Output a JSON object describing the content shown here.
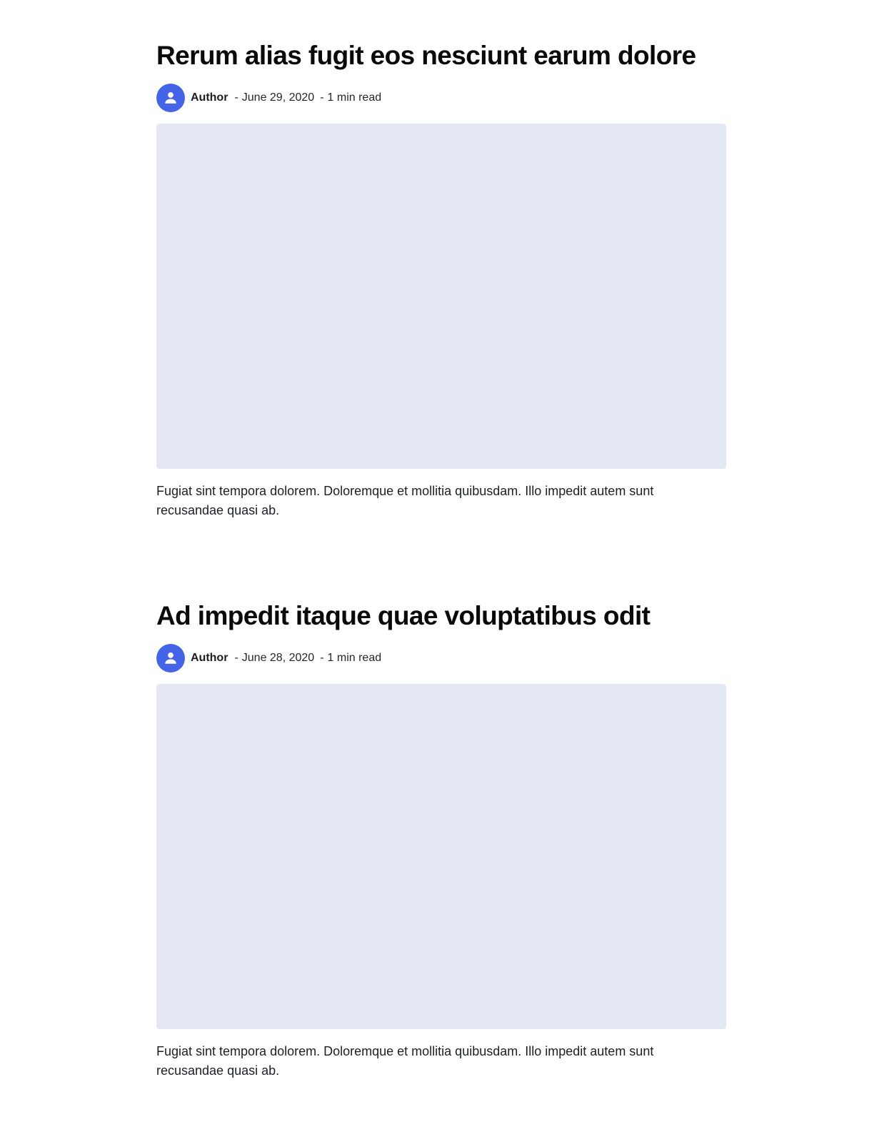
{
  "posts": [
    {
      "title": "Rerum alias fugit eos nesciunt earum dolore",
      "author": "Author",
      "date_sep": "-",
      "date": "June 29, 2020",
      "read_sep": "-",
      "read_time": "1 min read",
      "excerpt": "Fugiat sint tempora dolorem. Doloremque et mollitia quibusdam. Illo impedit autem sunt recusandae quasi ab."
    },
    {
      "title": "Ad impedit itaque quae voluptatibus odit",
      "author": "Author",
      "date_sep": "-",
      "date": "June 28, 2020",
      "read_sep": "-",
      "read_time": "1 min read",
      "excerpt": "Fugiat sint tempora dolorem. Doloremque et mollitia quibusdam. Illo impedit autem sunt recusandae quasi ab."
    }
  ],
  "icons": {
    "avatar": "user-icon"
  },
  "colors": {
    "avatar_bg": "#4464e8",
    "image_placeholder": "#e3e8f4",
    "title": "#0a0a0a",
    "text": "#1c1f27"
  }
}
